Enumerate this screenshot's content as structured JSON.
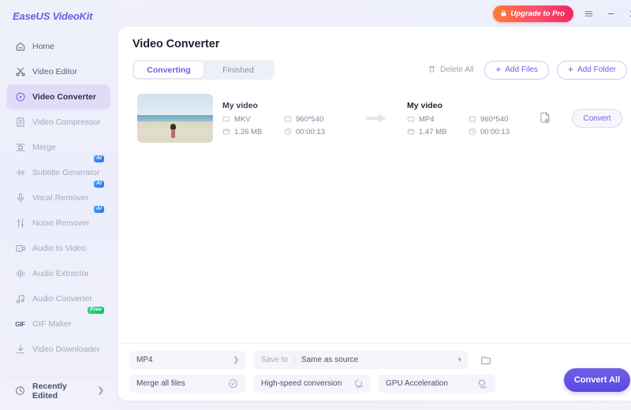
{
  "app": {
    "logo": "EaseUS VideoKit",
    "upgrade_label": "Upgrade to Pro",
    "accent": "#6f5fe0",
    "upgrade_gradient_from": "#ff7a35",
    "upgrade_gradient_to": "#f0285f"
  },
  "window_controls": {
    "menu": "menu-icon",
    "minimize": "minimize-icon",
    "close": "close-icon"
  },
  "sidebar": {
    "items": [
      {
        "label": "Home",
        "icon": "home-icon",
        "active": false,
        "badge": ""
      },
      {
        "label": "Video Editor",
        "icon": "scissors-icon",
        "active": false,
        "badge": ""
      },
      {
        "label": "Video Converter",
        "icon": "video-converter-icon",
        "active": true,
        "badge": ""
      },
      {
        "label": "Video Compressor",
        "icon": "compress-icon",
        "active": false,
        "badge": ""
      },
      {
        "label": "Merge",
        "icon": "merge-icon",
        "active": false,
        "badge": ""
      },
      {
        "label": "Subtitle Generator",
        "icon": "waveform-icon",
        "active": false,
        "badge": "AI"
      },
      {
        "label": "Vocal Remover",
        "icon": "microphone-icon",
        "active": false,
        "badge": "AI"
      },
      {
        "label": "Noise Remover",
        "icon": "sliders-icon",
        "active": false,
        "badge": "AI"
      },
      {
        "label": "Audio to Video",
        "icon": "audio-to-video-icon",
        "active": false,
        "badge": ""
      },
      {
        "label": "Audio Extractor",
        "icon": "audio-wave-icon",
        "active": false,
        "badge": ""
      },
      {
        "label": "Audio Converter",
        "icon": "music-note-icon",
        "active": false,
        "badge": ""
      },
      {
        "label": "GIF Maker",
        "icon": "gif-icon",
        "active": false,
        "badge": "Free"
      },
      {
        "label": "Video Downloader",
        "icon": "download-icon",
        "active": false,
        "badge": ""
      }
    ],
    "recent": {
      "label": "Recently Edited",
      "icon": "clock-icon",
      "chevron": "chevron-right-icon"
    },
    "badge_colors": {
      "ai": "#1f6ff0",
      "free": "#06c167"
    }
  },
  "main": {
    "title": "Video Converter",
    "tabs": [
      {
        "label": "Converting",
        "active": true
      },
      {
        "label": "Finished",
        "active": false
      }
    ],
    "actions": {
      "delete_all": "Delete All",
      "add_files": "Add Files",
      "add_folder": "Add Folder"
    }
  },
  "files": [
    {
      "thumbnail": "beach-video-thumbnail",
      "source": {
        "name": "My video",
        "format": "MKV",
        "resolution": "960*540",
        "size": "1.26 MB",
        "duration": "00:00:13"
      },
      "target": {
        "name": "My video",
        "format": "MP4",
        "resolution": "960*540",
        "size": "1.47 MB",
        "duration": "00:00:13"
      },
      "convert_label": "Convert",
      "settings_icon": "file-settings-icon"
    }
  ],
  "bottom": {
    "format_value": "MP4",
    "save_to_label": "Save to",
    "save_to_value": "Same as source",
    "folder_icon": "folder-icon",
    "merge_label": "Merge all files",
    "merge_state": "off",
    "high_speed_label": "High-speed conversion",
    "high_speed_state": "OFF",
    "gpu_label": "GPU Acceleration",
    "gpu_state": "OFF",
    "convert_all_label": "Convert All",
    "convert_all_color": "#5a48e0"
  }
}
